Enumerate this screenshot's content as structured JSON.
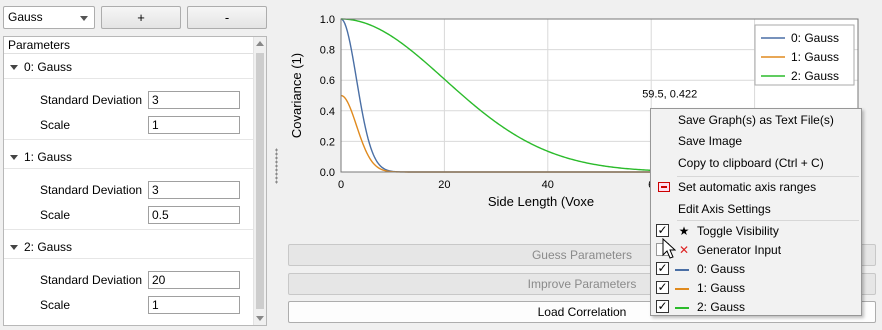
{
  "toolbar": {
    "model_select": "Gauss",
    "add_label": "+",
    "remove_label": "-"
  },
  "tree": {
    "header": "Parameters",
    "groups": [
      {
        "title": "0: Gauss",
        "params": [
          {
            "name": "Standard Deviation",
            "value": "3"
          },
          {
            "name": "Scale",
            "value": "1"
          }
        ]
      },
      {
        "title": "1: Gauss",
        "params": [
          {
            "name": "Standard Deviation",
            "value": "3"
          },
          {
            "name": "Scale",
            "value": "0.5"
          }
        ]
      },
      {
        "title": "2: Gauss",
        "params": [
          {
            "name": "Standard Deviation",
            "value": "20"
          },
          {
            "name": "Scale",
            "value": "1"
          }
        ]
      }
    ]
  },
  "chart_data": {
    "type": "line",
    "xlabel": "Side Length (Voxe",
    "ylabel": "Covariance (1)",
    "xlim": [
      0,
      100
    ],
    "ylim": [
      0,
      1.0
    ],
    "x_ticks": [
      "0",
      "20",
      "40",
      "6"
    ],
    "x_tick_right_fragment": "0",
    "y_ticks": [
      "0.0",
      "0.2",
      "0.4",
      "0.6",
      "0.8",
      "1.0"
    ],
    "grid": true,
    "legend_position": "top-right",
    "cursor_readout": "59.5, 0.422",
    "series": [
      {
        "name": "0: Gauss",
        "color": "#4a6fa5",
        "std": 3,
        "scale": 1
      },
      {
        "name": "1: Gauss",
        "color": "#e08a1e",
        "std": 3,
        "scale": 0.5
      },
      {
        "name": "2: Gauss",
        "color": "#2bbb2b",
        "std": 20,
        "scale": 1
      }
    ]
  },
  "buttons": {
    "guess": "Guess Parameters",
    "improve": "Improve Parameters",
    "load": "Load Correlation"
  },
  "menu": {
    "save_text": "Save Graph(s) as Text File(s)",
    "save_image": "Save Image",
    "copy": "Copy to clipboard (Ctrl + C)",
    "auto_axis": "Set automatic axis ranges",
    "edit_axis": "Edit Axis Settings",
    "toggle_visibility": "Toggle Visibility",
    "generator_input": "Generator Input",
    "series0": "0: Gauss",
    "series1": "1: Gauss",
    "series2": "2: Gauss",
    "check_mark": "✓"
  }
}
